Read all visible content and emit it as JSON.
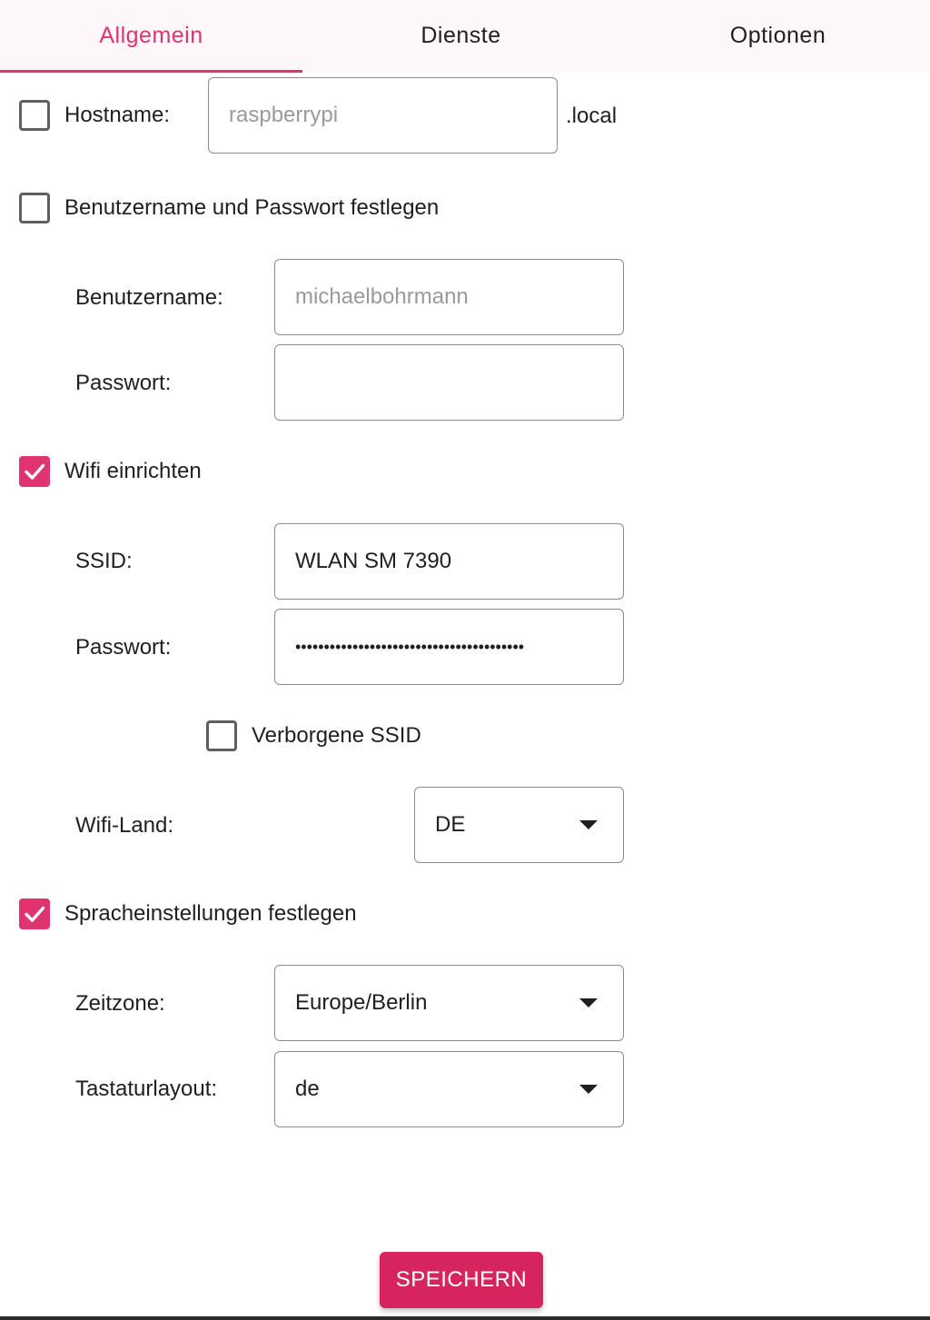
{
  "tabs": {
    "general": "Allgemein",
    "services": "Dienste",
    "options": "Optionen"
  },
  "hostname": {
    "checkbox_checked": false,
    "label": "Hostname:",
    "placeholder": "raspberrypi",
    "suffix": ".local"
  },
  "user": {
    "checkbox_checked": false,
    "checkbox_label": "Benutzername und Passwort festlegen",
    "username_label": "Benutzername:",
    "username_placeholder": "michaelbohrmann",
    "password_label": "Passwort:",
    "password_value": ""
  },
  "wifi": {
    "checkbox_checked": true,
    "checkbox_label": "Wifi einrichten",
    "ssid_label": "SSID:",
    "ssid_value": "WLAN SM 7390",
    "password_label": "Passwort:",
    "password_value": "••••••••••••••••••••••••••••••••••••••••",
    "hidden_ssid_checked": false,
    "hidden_ssid_label": "Verborgene SSID",
    "country_label": "Wifi-Land:",
    "country_value": "DE"
  },
  "locale": {
    "checkbox_checked": true,
    "checkbox_label": "Spracheinstellungen festlegen",
    "timezone_label": "Zeitzone:",
    "timezone_value": "Europe/Berlin",
    "keyboard_label": "Tastaturlayout:",
    "keyboard_value": "de"
  },
  "actions": {
    "save_label": "SPEICHERN"
  },
  "colors": {
    "accent": "#e0336f",
    "button": "#d6255e"
  }
}
